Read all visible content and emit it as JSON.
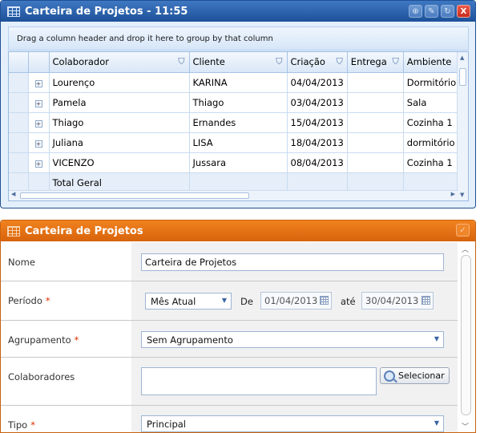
{
  "grid_panel": {
    "title": "Carteira de Projetos - 11:55",
    "group_hint": "Drag a column header and drop it here to group by that column",
    "tool_icons": [
      "zoom-icon",
      "edit-icon",
      "refresh-icon",
      "close-icon"
    ],
    "columns": [
      "Colaborador",
      "Cliente",
      "Criação",
      "Entrega",
      "Ambiente"
    ],
    "rows": [
      {
        "colaborador": "Lourenço",
        "cliente": "KARINA",
        "criacao": "04/04/2013",
        "entrega": "",
        "ambiente": "Dormitório"
      },
      {
        "colaborador": "Pamela",
        "cliente": "Thiago",
        "criacao": "03/04/2013",
        "entrega": "",
        "ambiente": "Sala"
      },
      {
        "colaborador": "Thiago",
        "cliente": "Ernandes",
        "criacao": "15/04/2013",
        "entrega": "",
        "ambiente": "Cozinha 1"
      },
      {
        "colaborador": "Juliana",
        "cliente": "LISA",
        "criacao": "18/04/2013",
        "entrega": "",
        "ambiente": "dormitório"
      },
      {
        "colaborador": "VICENZO",
        "cliente": "Jussara",
        "criacao": "08/04/2013",
        "entrega": "",
        "ambiente": "Cozinha 1"
      }
    ],
    "total_label": "Total Geral",
    "expander_symbol": "+",
    "close_label": "X"
  },
  "form_panel": {
    "title": "Carteira de Projetos",
    "fields": {
      "nome": {
        "label": "Nome",
        "value": "Carteira de Projetos"
      },
      "periodo": {
        "label": "Período",
        "required": "*",
        "select_value": "Mês Atual",
        "de_label": "De",
        "de_value": "01/04/2013",
        "ate_label": "até",
        "ate_value": "30/04/2013"
      },
      "agrupamento": {
        "label": "Agrupamento",
        "required": "*",
        "value": "Sem Agrupamento"
      },
      "colaboradores": {
        "label": "Colaboradores",
        "value": "",
        "button_label": "Selecionar"
      },
      "tipo": {
        "label": "Tipo",
        "required": "*",
        "value": "Principal"
      }
    }
  },
  "colors": {
    "grid_header": "#1d5199",
    "form_header": "#e2700f",
    "required": "#e02d00"
  }
}
